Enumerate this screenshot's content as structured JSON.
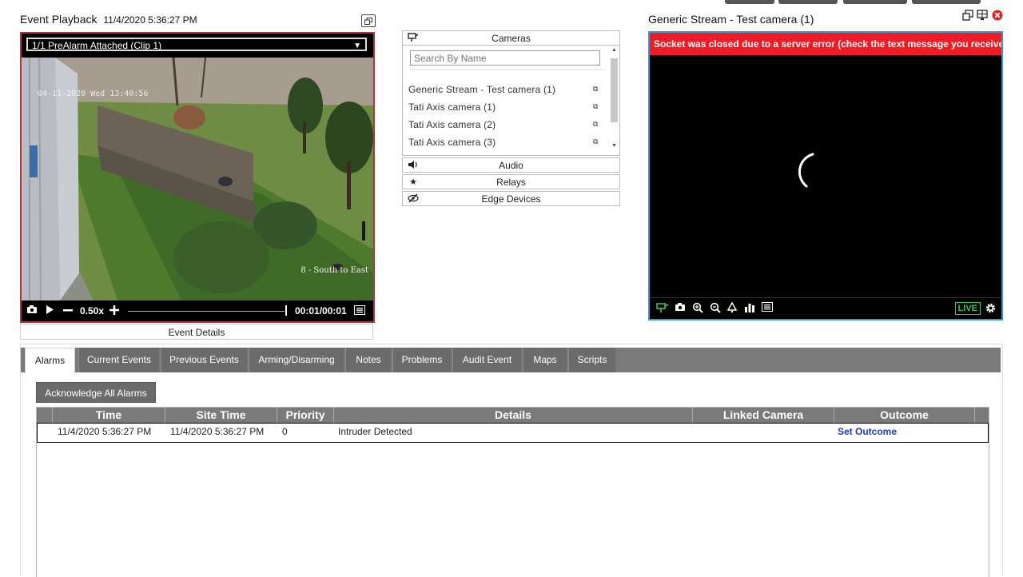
{
  "playback": {
    "title": "Event Playback",
    "datetime": "11/4/2020 5:36:27 PM",
    "clip_select": "1/1 PreAlarm Attached (Clip 1)",
    "osd_timestamp": "04-11-2020 Wed 13:40:56",
    "osd_camera": "8 - South to East",
    "speed": "0.50x",
    "time": "00:01/00:01",
    "progress": 1.0,
    "event_details_label": "Event Details"
  },
  "accordion": {
    "cameras_label": "Cameras",
    "search_placeholder": "Search By Name",
    "cameras": [
      {
        "name": "Generic Stream - Test camera (1)"
      },
      {
        "name": "Tati Axis camera (1)"
      },
      {
        "name": "Tati Axis camera (2)"
      },
      {
        "name": "Tati Axis camera (3)"
      }
    ],
    "audio_label": "Audio",
    "relays_label": "Relays",
    "edge_label": "Edge Devices"
  },
  "live": {
    "title": "Generic Stream - Test camera (1)",
    "error": "Socket was closed due to a server error (check the text message you received f",
    "live_badge": "LIVE",
    "accent_color": "#3b95d0",
    "error_color": "#ee1c25"
  },
  "tabs": [
    {
      "label": "Alarms"
    },
    {
      "label": "Current Events"
    },
    {
      "label": "Previous Events"
    },
    {
      "label": "Arming/Disarming"
    },
    {
      "label": "Notes"
    },
    {
      "label": "Problems"
    },
    {
      "label": "Audit Event"
    },
    {
      "label": "Maps"
    },
    {
      "label": "Scripts"
    }
  ],
  "alarms": {
    "ack_label": "Acknowledge All Alarms",
    "columns": [
      "Time",
      "Site Time",
      "Priority",
      "Details",
      "Linked Camera",
      "Outcome"
    ],
    "rows": [
      {
        "time": "11/4/2020 5:36:27 PM",
        "site_time": "11/4/2020 5:36:27 PM",
        "priority": "0",
        "details": "Intruder Detected",
        "linked_camera": "",
        "outcome": "Set Outcome"
      }
    ]
  }
}
